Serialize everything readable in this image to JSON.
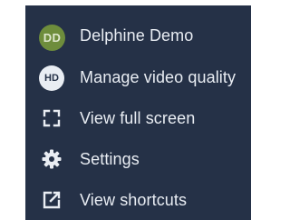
{
  "menu": {
    "user": {
      "initials": "DD",
      "name": "Delphine Demo",
      "avatar_color": "#6e8d3c"
    },
    "items": [
      {
        "label": "Manage video quality",
        "icon": "hd-icon",
        "badge": "HD"
      },
      {
        "label": "View full screen",
        "icon": "fullscreen-icon"
      },
      {
        "label": "Settings",
        "icon": "gear-icon"
      },
      {
        "label": "View shortcuts",
        "icon": "external-link-icon"
      }
    ]
  },
  "colors": {
    "menu_background": "#253147",
    "text": "#e9edf3"
  }
}
